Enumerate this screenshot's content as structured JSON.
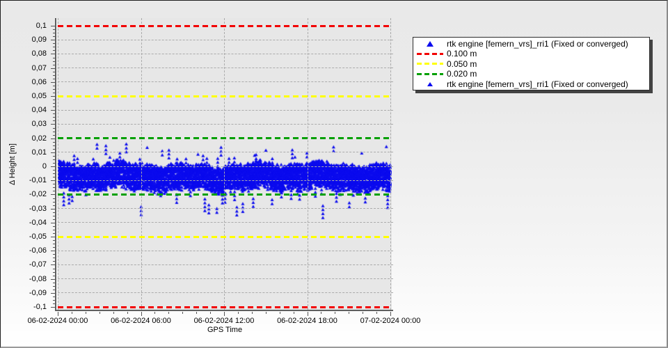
{
  "window": {
    "background_top": "#e9e9e9",
    "background_bottom": "#ffffff",
    "plot_background": "#e7e7e7",
    "grid_color": "#ababab",
    "axis_color": "#5f5f5f"
  },
  "chart_data": {
    "type": "scatter",
    "xlabel": "GPS Time",
    "ylabel": "Δ Height [m]",
    "x_axis": {
      "title": "GPS Time",
      "tick_labels": [
        "06-02-2024 00:00",
        "06-02-2024 06:00",
        "06-02-2024 12:00",
        "06-02-2024 18:00",
        "07-02-2024 00:00"
      ],
      "hours_span": 24,
      "major_tick_hours": 6,
      "minor_tick_hours": 1
    },
    "y_axis": {
      "title": "Δ Height [m]",
      "min": -0.1,
      "max": 0.1,
      "tick_step": 0.01,
      "minor_tick_step": 0.0025,
      "decimal_separator": ",",
      "tick_labels": [
        "0,1",
        "0,09",
        "0,08",
        "0,07",
        "0,06",
        "0,05",
        "0,04",
        "0,03",
        "0,02",
        "0,01",
        "0",
        "-0,01",
        "-0,02",
        "-0,03",
        "-0,04",
        "-0,05",
        "-0,06",
        "-0,07",
        "-0,08",
        "-0,09",
        "-0,1"
      ]
    },
    "grid": {
      "show": true,
      "style": "dashed"
    },
    "thresholds": [
      {
        "label": "0.100 m",
        "values": [
          0.1,
          -0.1
        ],
        "color": "#f20000",
        "style": "dashed"
      },
      {
        "label": "0.050 m",
        "values": [
          0.05,
          -0.05
        ],
        "color": "#ffff00",
        "style": "dashed"
      },
      {
        "label": "0.020 m",
        "values": [
          0.02,
          -0.02
        ],
        "color": "#00a000",
        "style": "dashed"
      }
    ],
    "series": [
      {
        "name": "rtk engine [femern_vrs]_rri1 (Fixed or converged)",
        "marker": "triangle",
        "color": "#0b0bee",
        "band_summary": {
          "mean": -0.007,
          "typical_top": 0.005,
          "typical_bottom": -0.019,
          "extreme_max": 0.016,
          "extreme_min": -0.036,
          "x_start": "06-02-2024 00:00",
          "x_end": "07-02-2024 00:00"
        },
        "render": {
          "seed": 20240206,
          "columns": 1500,
          "col_top_base": -0.0025,
          "col_top_jitter": 0.005,
          "col_depth": 0.0155,
          "points_per_col_min": 3,
          "points_per_col_max": 6,
          "down_spike_prob": 0.02,
          "up_spike_prob": 0.015,
          "marker_px": 5
        }
      }
    ],
    "legend": {
      "items": [
        {
          "swatch": "triangle",
          "size": "large",
          "color": "#0b0bee",
          "label": "rtk engine [femern_vrs]_rri1 (Fixed or converged)"
        },
        {
          "swatch": "dash",
          "color": "#f20000",
          "label": "0.100 m"
        },
        {
          "swatch": "dash",
          "color": "#ffff00",
          "label": "0.050 m"
        },
        {
          "swatch": "dash",
          "color": "#00a000",
          "label": "0.020 m"
        },
        {
          "swatch": "triangle",
          "size": "small",
          "color": "#0b0bee",
          "label": "rtk engine [femern_vrs]_rri1 (Fixed or converged)"
        }
      ]
    }
  }
}
